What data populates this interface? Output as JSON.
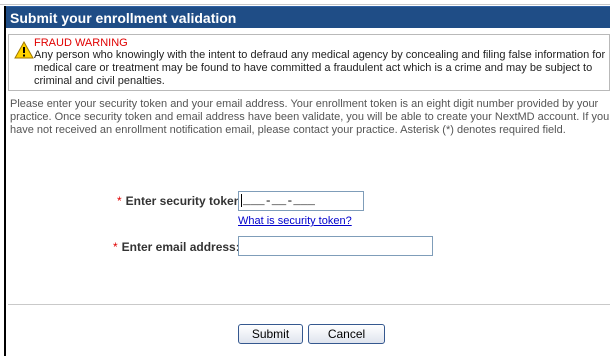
{
  "dialog": {
    "title": "Submit your enrollment validation"
  },
  "warning": {
    "icon": "warning-icon",
    "title": "FRAUD WARNING",
    "text": "Any person who knowingly with the intent to defraud any medical agency by concealing and filing false information for medical care or treatment may be found to have committed a fraudulent act which is a crime and may be subject to criminal and civil penalties.",
    "title_color": "#e00000"
  },
  "instructions": "Please enter your security token and your email address. Your enrollment token is an eight digit number provided by your practice. Once security token and email address have been validate, you will be able to create your NextMD account. If you have not received an enrollment notification email, please contact your practice. Asterisk (*) denotes required field.",
  "form": {
    "required_marker": "*",
    "token_label": "Enter security token:",
    "token_value": "___-__-___",
    "token_help_link": "What is security token?",
    "email_label": "Enter email address:",
    "email_value": ""
  },
  "buttons": {
    "submit": "Submit",
    "cancel": "Cancel"
  },
  "colors": {
    "titlebar": "#1f4d86",
    "required": "#e00000",
    "link": "#0000cc"
  }
}
